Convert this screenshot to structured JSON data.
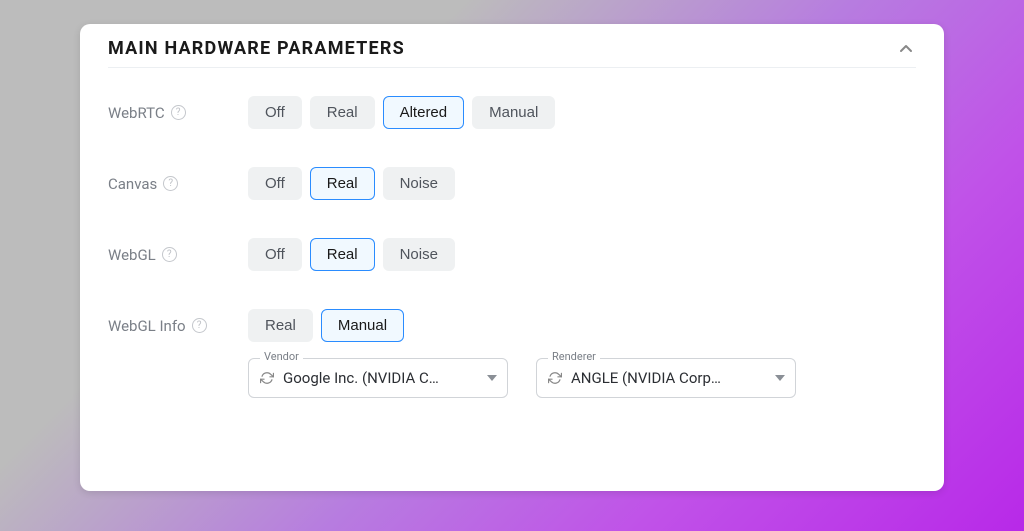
{
  "title": "MAIN HARDWARE PARAMETERS",
  "rows": {
    "webrtc": {
      "label": "WebRTC",
      "options": [
        "Off",
        "Real",
        "Altered",
        "Manual"
      ],
      "selected": "Altered"
    },
    "canvas": {
      "label": "Canvas",
      "options": [
        "Off",
        "Real",
        "Noise"
      ],
      "selected": "Real"
    },
    "webgl": {
      "label": "WebGL",
      "options": [
        "Off",
        "Real",
        "Noise"
      ],
      "selected": "Real"
    },
    "webglinfo": {
      "label": "WebGL Info",
      "options": [
        "Real",
        "Manual"
      ],
      "selected": "Manual"
    }
  },
  "fields": {
    "vendor": {
      "label": "Vendor",
      "value": "Google Inc. (NVIDIA C…"
    },
    "renderer": {
      "label": "Renderer",
      "value": "ANGLE (NVIDIA Corp…"
    }
  }
}
